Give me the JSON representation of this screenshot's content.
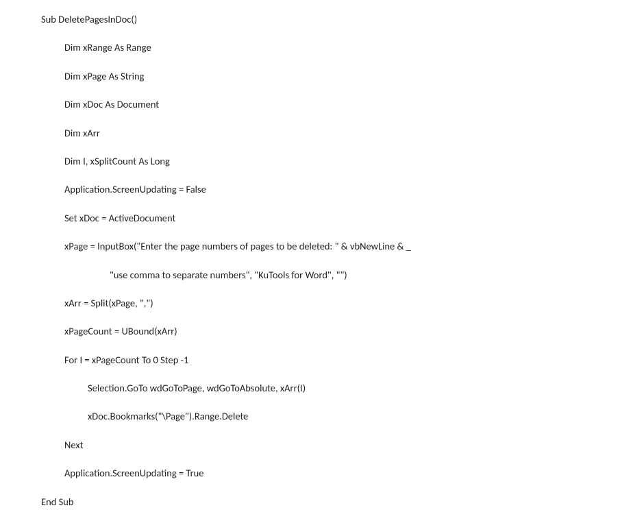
{
  "code": {
    "lines": [
      {
        "indent": 0,
        "text": "Sub DeletePagesInDoc()"
      },
      {
        "indent": 1,
        "text": "Dim xRange As Range"
      },
      {
        "indent": 1,
        "text": "Dim xPage As String"
      },
      {
        "indent": 1,
        "text": "Dim xDoc As Document"
      },
      {
        "indent": 1,
        "text": "Dim xArr"
      },
      {
        "indent": 1,
        "text": "Dim I, xSplitCount As Long"
      },
      {
        "indent": 1,
        "text": "Application.ScreenUpdating = False"
      },
      {
        "indent": 1,
        "text": "Set xDoc = ActiveDocument"
      },
      {
        "indent": 1,
        "text": "xPage = InputBox(\"Enter the page numbers of pages to be deleted: \" & vbNewLine & _"
      },
      {
        "indent": 3,
        "text": "\"use comma to separate numbers\", \"KuTools for Word\", \"\")"
      },
      {
        "indent": 1,
        "text": "xArr = Split(xPage, \",\")"
      },
      {
        "indent": 1,
        "text": "xPageCount = UBound(xArr)"
      },
      {
        "indent": 1,
        "text": "For I = xPageCount To 0 Step -1"
      },
      {
        "indent": 2,
        "text": "Selection.GoTo wdGoToPage, wdGoToAbsolute, xArr(I)"
      },
      {
        "indent": 2,
        "text": "xDoc.Bookmarks(\"\\Page\").Range.Delete"
      },
      {
        "indent": 1,
        "text": "Next"
      },
      {
        "indent": 1,
        "text": "Application.ScreenUpdating = True"
      },
      {
        "indent": 0,
        "text": "End Sub"
      }
    ]
  }
}
